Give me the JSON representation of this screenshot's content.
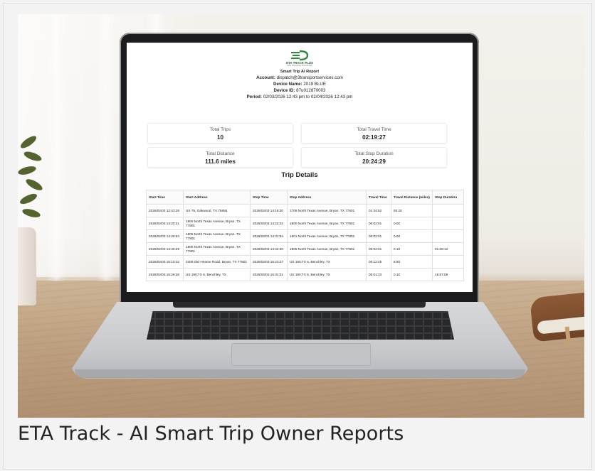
{
  "caption": "ETA Track - AI Smart Trip Owner Reports",
  "report": {
    "logo_text": "ETA TRACK PLUS",
    "logo_sub": "GPS TRACKING SOLUTIONS",
    "title": "Smart Trip AI Report",
    "account_label": "Account:",
    "account_value": "dispatch@3transportservices.com",
    "device_name_label": "Device Name:",
    "device_name_value": "2019 BLUE",
    "device_id_label": "Device ID:",
    "device_id_value": "87u012870003",
    "period_label": "Period:",
    "period_value": "02/03/2026 12:43 pm to 02/04/2026 12:43 pm"
  },
  "summary": {
    "total_trips_label": "Total Trips",
    "total_trips_value": "10",
    "total_travel_time_label": "Total Travel Time",
    "total_travel_time_value": "02:19:27",
    "total_distance_label": "Total Distance",
    "total_distance_value": "111.6 miles",
    "total_stop_duration_label": "Total Stop Duration",
    "total_stop_duration_value": "20:24:29"
  },
  "trip_details": {
    "title": "Trip Details",
    "headers": [
      "Start Time",
      "Start Address",
      "Stop Time",
      "Stop Address",
      "Travel Time",
      "Travel Distance (miles)",
      "Stop Duration"
    ],
    "rows": [
      [
        "2026/02/03 12:43:28",
        "US 79, Oakwood, TX 75855",
        "2026/02/03 14:18:20",
        "1709 North Texas Avenue, Bryan, TX 77801",
        "01:34:52",
        "93.20",
        ""
      ],
      [
        "2026/02/03 14:20:21",
        "1800 North Texas Avenue, Bryan, TX 77801",
        "2026/02/03 14:22:22",
        "1800 North Texas Avenue, Bryan, TX 77801",
        "00:02:01",
        "0.00",
        ""
      ],
      [
        "2026/02/03 14:29:53",
        "1805 North Texas Avenue, Bryan, TX 77801",
        "2026/02/03 14:31:54",
        "1901 North Texas Avenue, Bryan, TX 77801",
        "00:02:01",
        "0.00",
        ""
      ],
      [
        "2026/02/03 14:40:29",
        "1805 North Texas Avenue, Bryan, TX 77801",
        "2026/02/03 14:42:30",
        "1805 North Texas Avenue, Bryan, TX 77801",
        "00:02:01",
        "0.10",
        "01:28:12"
      ],
      [
        "2026/02/03 16:10:42",
        "2409 Old Hearne Road, Bryan, TX 77801",
        "2026/02/03 16:23:27",
        "US 190;TX 6, Benchley, TX",
        "00:12:45",
        "8.50",
        ""
      ],
      [
        "2026/02/03 16:29:28",
        "US 190;TX 6, Benchley, TX",
        "2026/02/03 16:31:01",
        "US 190;TX 6, Benchley, TX",
        "00:01:33",
        "0.10",
        "16:57:59"
      ]
    ]
  },
  "colors": {
    "logo_green": "#2f8a3c",
    "logo_blue": "#1f5fa8"
  }
}
